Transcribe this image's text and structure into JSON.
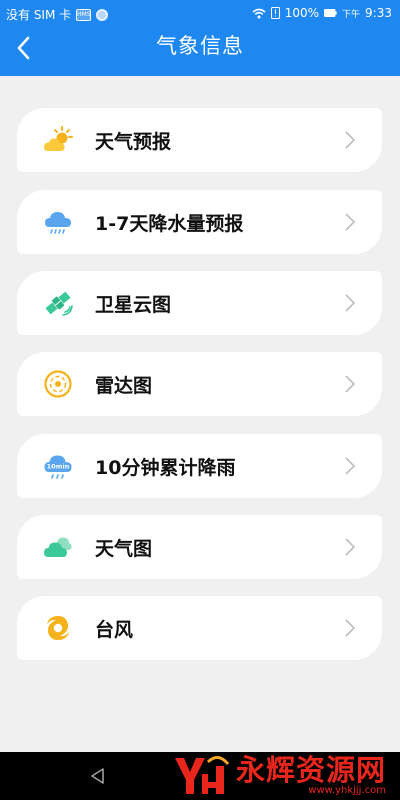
{
  "status_bar": {
    "carrier": "没有 SIM 卡",
    "sim_badge": "HMS",
    "battery": "100%",
    "time_prefix": "下午",
    "time": "9:33"
  },
  "header": {
    "title": "气象信息",
    "back_icon": "chevron-left-icon",
    "background": "#1e88f0"
  },
  "menu": [
    {
      "label": "天气预报",
      "icon": "sun-cloud-icon"
    },
    {
      "label": "1-7天降水量预报",
      "icon": "rain-cloud-icon"
    },
    {
      "label": "卫星云图",
      "icon": "satellite-icon"
    },
    {
      "label": "雷达图",
      "icon": "radar-icon"
    },
    {
      "label": "10分钟累计降雨",
      "icon": "rain-10min-icon",
      "icon_text": "10min"
    },
    {
      "label": "天气图",
      "icon": "cloud-icon"
    },
    {
      "label": "台风",
      "icon": "typhoon-icon"
    }
  ],
  "watermark": {
    "logo": "YH",
    "title": "永辉资源网",
    "url": "www.yhkjjj.com"
  }
}
